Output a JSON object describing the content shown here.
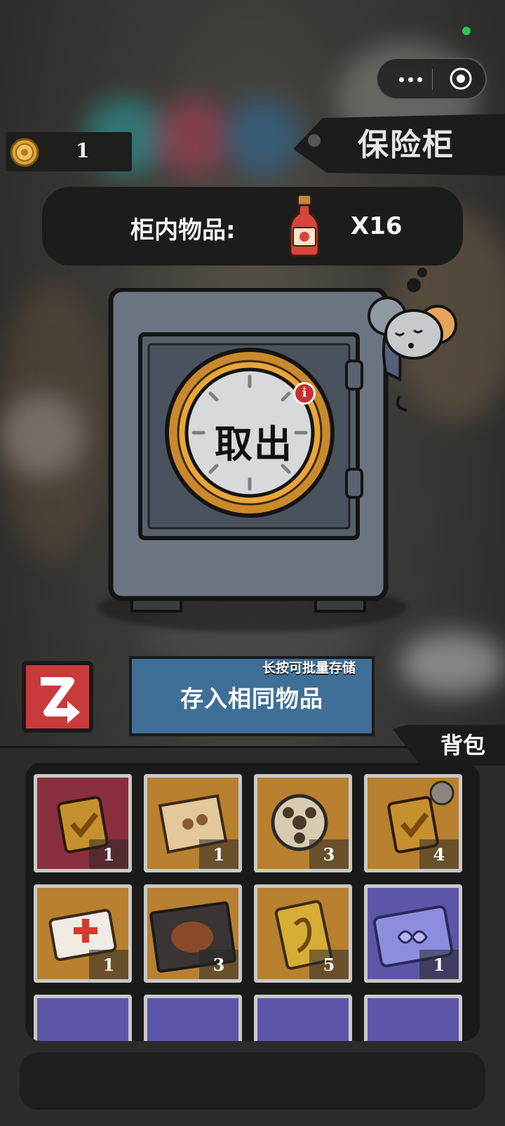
{
  "header": {
    "coins": "1",
    "title": "保险柜"
  },
  "safe": {
    "contents_label": "柜内物品:",
    "contents_icon": "ketchup-bottle-icon",
    "contents_count": "X16",
    "withdraw_label": "取出",
    "info_icon": "i"
  },
  "actions": {
    "store_label": "存入相同物品",
    "store_hint": "长按可批量存储",
    "refresh_icon": "refresh-icon"
  },
  "bag": {
    "tab_label": "背包",
    "items": [
      {
        "icon": "shield-check-card-icon",
        "qty": "1",
        "bg": "#8a2f3d"
      },
      {
        "icon": "paw-print-map-icon",
        "qty": "1",
        "bg": "#b8802f"
      },
      {
        "icon": "film-reel-icon",
        "qty": "3",
        "bg": "#b8802f"
      },
      {
        "icon": "shield-check-card-star-icon",
        "qty": "4",
        "bg": "#b8802f"
      },
      {
        "icon": "medical-card-icon",
        "qty": "1",
        "bg": "#b8802f"
      },
      {
        "icon": "steak-menu-icon",
        "qty": "3",
        "bg": "#b8802f"
      },
      {
        "icon": "ribbon-card-icon",
        "qty": "5",
        "bg": "#b8802f"
      },
      {
        "icon": "toy-ticket-icon",
        "qty": "1",
        "bg": "#5d56a8"
      },
      {
        "icon": "blue-card-icon",
        "qty": "",
        "bg": "#5d56a8"
      },
      {
        "icon": "blue-tag-icon",
        "qty": "",
        "bg": "#5d56a8"
      },
      {
        "icon": "first-aid-kit-icon",
        "qty": "",
        "bg": "#5d56a8"
      },
      {
        "icon": "gear-box-icon",
        "qty": "",
        "bg": "#5d56a8"
      }
    ]
  }
}
